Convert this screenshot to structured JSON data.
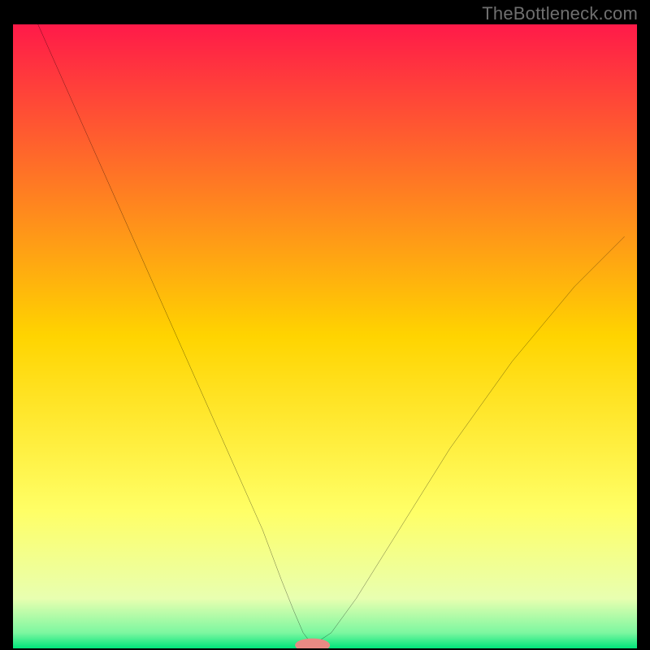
{
  "watermark": {
    "text": "TheBottleneck.com"
  },
  "chart_data": {
    "type": "line",
    "title": "",
    "xlabel": "",
    "ylabel": "",
    "xlim": [
      0,
      100
    ],
    "ylim": [
      0,
      100
    ],
    "grid": false,
    "legend": false,
    "background_gradient": {
      "stops": [
        {
          "offset": 0.0,
          "color": "#ff1a49"
        },
        {
          "offset": 0.5,
          "color": "#ffd400"
        },
        {
          "offset": 0.78,
          "color": "#ffff66"
        },
        {
          "offset": 0.92,
          "color": "#e8ffb0"
        },
        {
          "offset": 0.975,
          "color": "#7cf7a0"
        },
        {
          "offset": 1.0,
          "color": "#00e47a"
        }
      ]
    },
    "series": [
      {
        "name": "bottleneck-curve",
        "color": "#000000",
        "x": [
          4,
          8,
          12,
          16,
          20,
          24,
          28,
          32,
          36,
          40,
          43,
          45,
          46.5,
          48,
          51,
          55,
          60,
          65,
          70,
          75,
          80,
          85,
          90,
          95,
          98
        ],
        "y": [
          100,
          91,
          82,
          73,
          64,
          55,
          46,
          37,
          28,
          19,
          11,
          6,
          2.5,
          0.5,
          2.5,
          8,
          16,
          24,
          32,
          39,
          46,
          52,
          58,
          63,
          66
        ]
      }
    ],
    "marker": {
      "name": "optimal-marker",
      "x": 48,
      "y": 0.5,
      "color": "#e98a84",
      "rx": 2.8,
      "ry": 1.1
    }
  }
}
